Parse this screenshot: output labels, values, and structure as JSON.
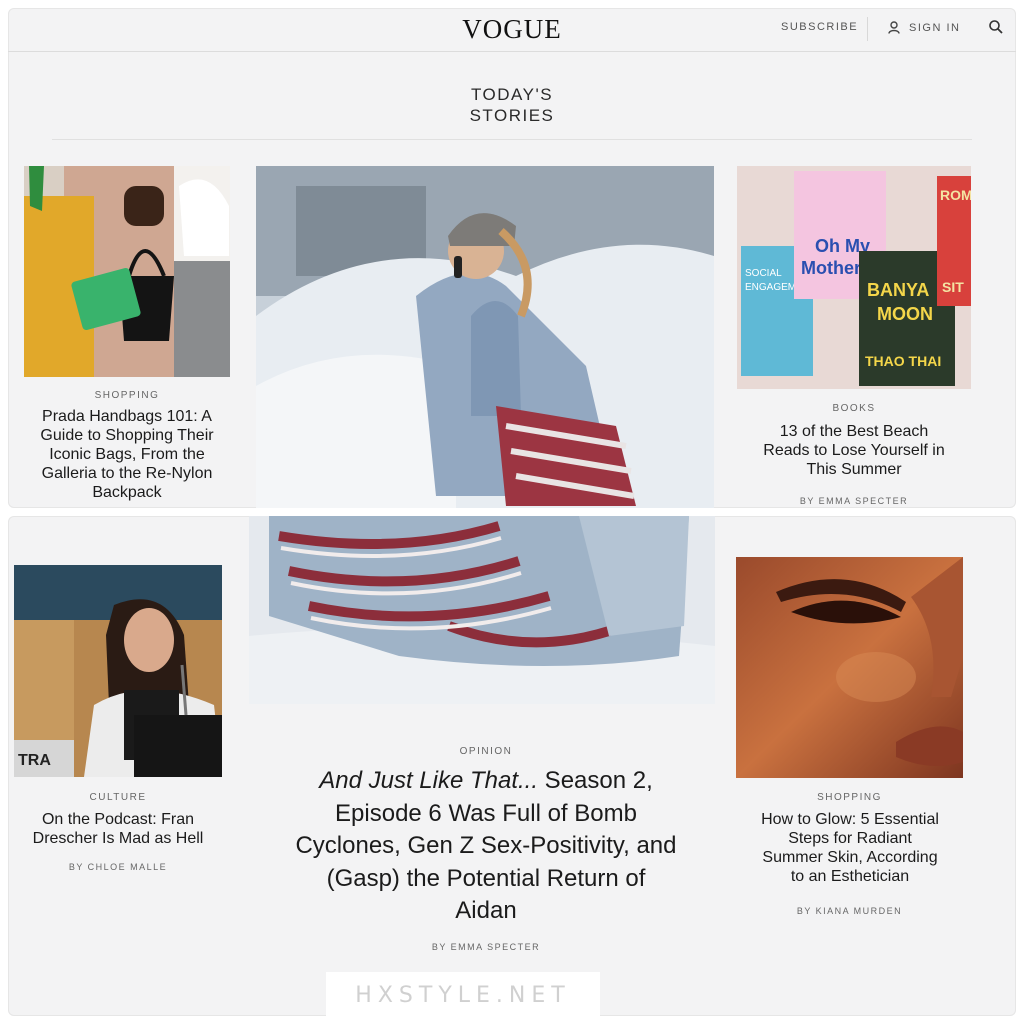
{
  "header": {
    "logo": "VOGUE",
    "subscribe_label": "SUBSCRIBE",
    "signin_label": "SIGN IN",
    "icons": [
      "user-icon",
      "search-icon"
    ]
  },
  "section_title_line1": "TODAY'S",
  "section_title_line2": "STORIES",
  "stories": {
    "prada": {
      "kicker": "SHOPPING",
      "headline_lines": [
        "Prada Handbags 101: A",
        "Guide to Shopping Their",
        "Iconic Bags, From the",
        "Galleria to the Re-Nylon",
        "Backpack"
      ]
    },
    "hero": {
      "kicker": "OPINION",
      "headline_italic": "And Just Like That...",
      "headline_rest_l1": " Season 2,",
      "headline_lines": [
        "Episode 6 Was Full of Bomb",
        "Cyclones, Gen Z Sex-Positivity, and",
        "(Gasp) the Potential Return of",
        "Aidan"
      ],
      "byline": "BY EMMA SPECTER"
    },
    "books": {
      "kicker": "BOOKS",
      "headline_lines": [
        "13 of the Best Beach",
        "Reads to Lose Yourself in",
        "This Summer"
      ],
      "byline": "BY EMMA SPECTER",
      "cover_texts": [
        "Oh My",
        "Mother",
        "BANYA",
        "MOON",
        "THAO THAI",
        "ROM",
        "SIT",
        "SOCIAL",
        "ENGAGEMENT"
      ]
    },
    "podcast": {
      "kicker": "CULTURE",
      "headline_lines": [
        "On the Podcast: Fran",
        "Drescher Is Mad as Hell"
      ],
      "byline": "BY CHLOE MALLE",
      "sign_text": "TRA"
    },
    "glow": {
      "kicker": "SHOPPING",
      "headline_lines": [
        "How to Glow: 5 Essential",
        "Steps for Radiant",
        "Summer Skin, According",
        "to an Esthetician"
      ],
      "byline": "BY KIANA MURDEN"
    }
  },
  "watermark": "HXSTYLE.NET"
}
